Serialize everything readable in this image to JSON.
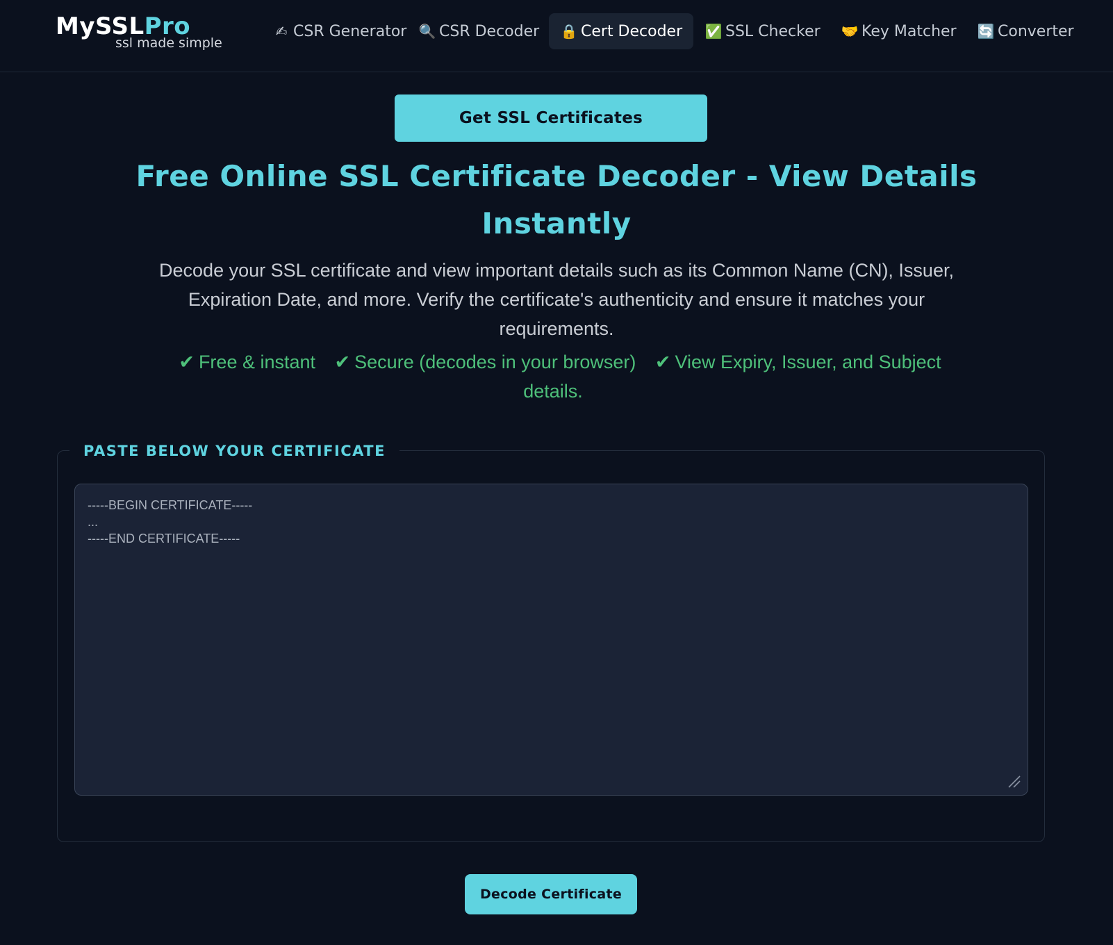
{
  "header": {
    "logo": {
      "my": "My",
      "ssl": "SSL",
      "pro": "Pro",
      "tagline": "ssl made simple"
    },
    "nav": [
      {
        "icon": "writing-hand-icon",
        "glyph": "✍",
        "label": "CSR Generator"
      },
      {
        "icon": "magnifier-icon",
        "glyph": "🔍",
        "label": "CSR Decoder"
      },
      {
        "icon": "lock-icon",
        "glyph": "🔒",
        "label": "Cert Decoder",
        "active": true
      },
      {
        "icon": "check-mark-icon",
        "glyph": "✅",
        "label": "SSL Checker"
      },
      {
        "icon": "handshake-icon",
        "glyph": "🤝",
        "label": "Key Matcher"
      },
      {
        "icon": "refresh-icon",
        "glyph": "🔄",
        "label": "Converter"
      }
    ]
  },
  "main": {
    "cta_label": "Get SSL Certificates",
    "title_line1": "Free Online SSL Certificate Decoder - View Details",
    "title_line2": "Instantly",
    "description": "Decode your SSL certificate and view important details such as its Common Name (CN), Issuer, Expiration Date, and more. Verify the certificate's authenticity and ensure it matches your requirements.",
    "features": [
      {
        "check": "✔",
        "text": "Free & instant"
      },
      {
        "check": "✔",
        "text": "Secure (decodes in your browser)"
      },
      {
        "check": "✔",
        "text": "View Expiry, Issuer, and Subject details."
      }
    ]
  },
  "form": {
    "legend": "PASTE BELOW YOUR CERTIFICATE",
    "textarea_placeholder": "-----BEGIN CERTIFICATE-----\n...\n-----END CERTIFICATE-----",
    "textarea_value": "",
    "submit_label": "Decode Certificate"
  },
  "colors": {
    "background": "#0b111e",
    "accent": "#5fd3e0",
    "feature_green": "#4ec07a",
    "input_bg": "#1b2336"
  }
}
